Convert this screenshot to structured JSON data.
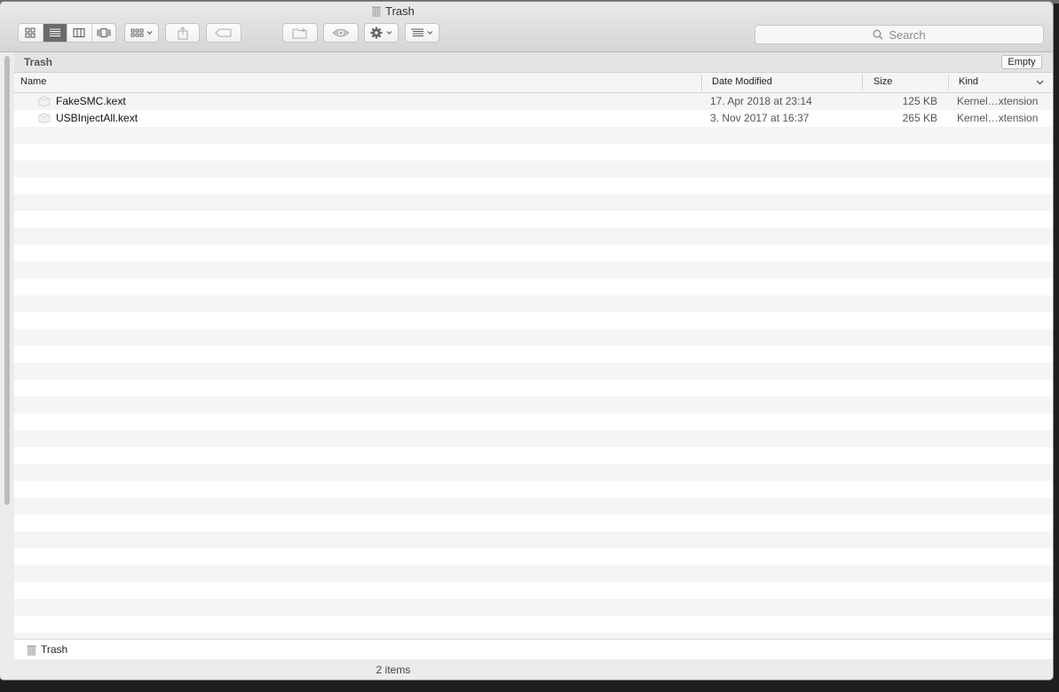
{
  "window": {
    "title": "Trash"
  },
  "toolbar": {
    "view_buttons": [
      "icon-view",
      "list-view",
      "column-view",
      "cover-flow-view"
    ],
    "search_placeholder": "Search"
  },
  "path_bar": {
    "title": "Trash",
    "empty_label": "Empty"
  },
  "columns": {
    "name": "Name",
    "date": "Date Modified",
    "size": "Size",
    "kind": "Kind"
  },
  "files": [
    {
      "name": "FakeSMC.kext",
      "date": "17. Apr 2018 at 23:14",
      "size": "125 KB",
      "kind": "Kernel…xtension"
    },
    {
      "name": "USBInjectAll.kext",
      "date": "3. Nov 2017 at 16:37",
      "size": "265 KB",
      "kind": "Kernel…xtension"
    }
  ],
  "bottom_path": {
    "label": "Trash"
  },
  "status": {
    "item_count": "2 items"
  },
  "colors": {
    "active_segment": "#6b6b6b",
    "window_bg": "#ececec"
  }
}
